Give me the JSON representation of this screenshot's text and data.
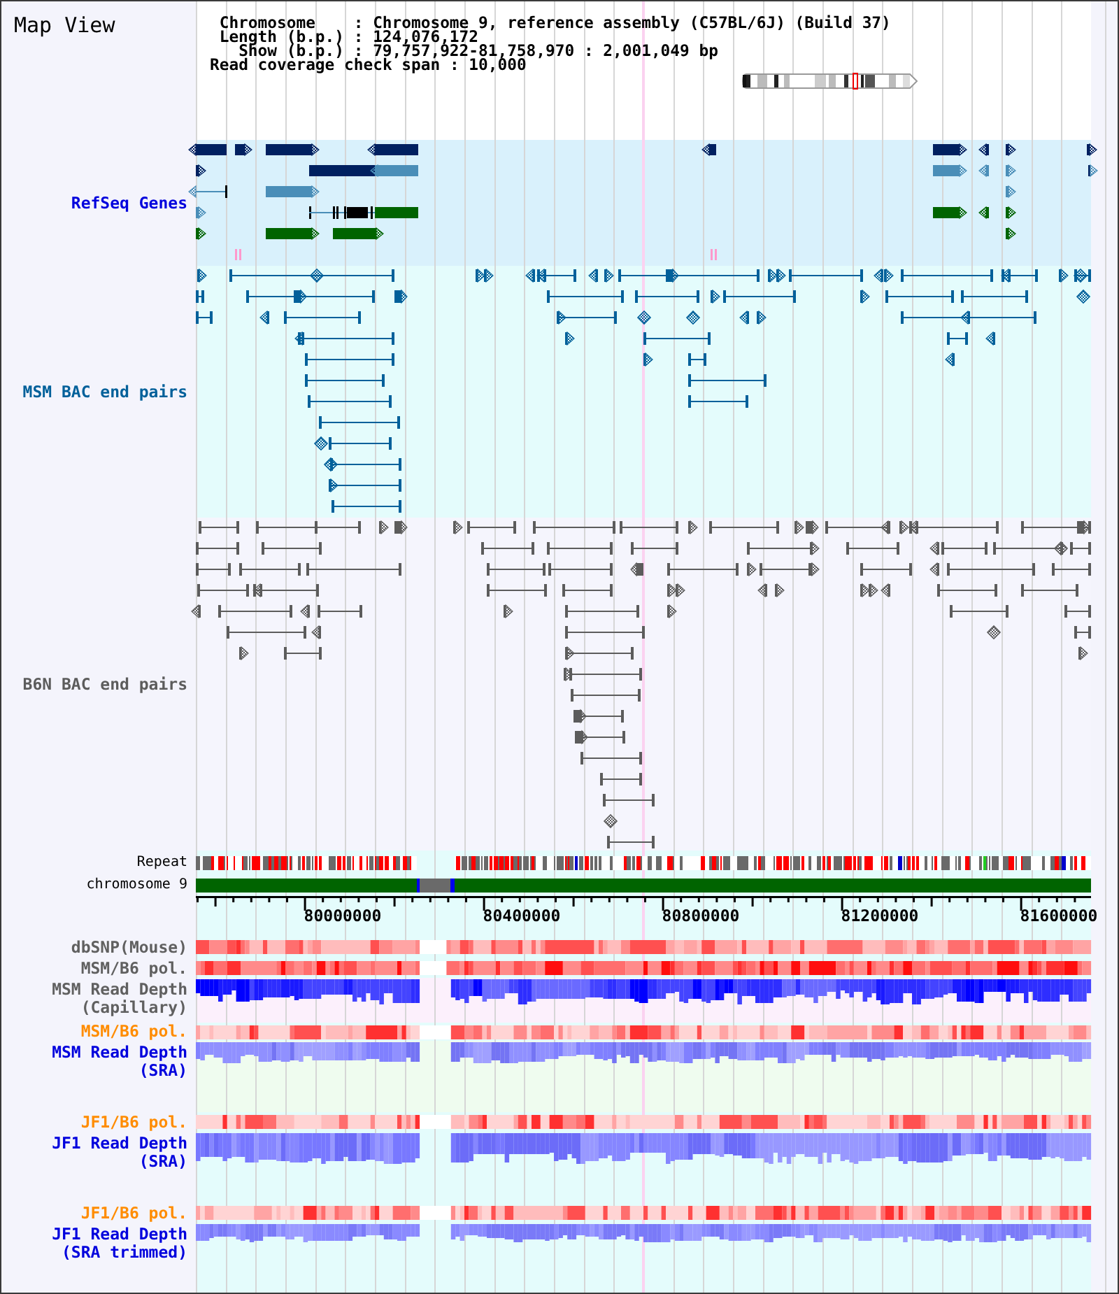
{
  "title": "Map View",
  "info": [
    "Chromosome    : Chromosome 9, reference assembly (C57BL/6J) (Build 37)",
    "Length (b.p.) : 124,076,172",
    "Show (b.p.) : 79,757,922-81,758,970 : 2,001,049 bp",
    "Read coverage check span : 10,000"
  ],
  "feature_tracks": [
    {
      "label": "RefSeq Genes",
      "kind": "genes",
      "color": "#0000dd"
    },
    {
      "label": "MSM BAC end pairs",
      "kind": "bac_pairs",
      "color": "#00609a"
    },
    {
      "label": "B6N BAC end pairs",
      "kind": "bac_pairs",
      "color": "#5c5c5c"
    }
  ],
  "reference_tracks": [
    {
      "label": "Repeat",
      "kind": "repeat"
    },
    {
      "label": "chromosome 9",
      "kind": "chromosome"
    }
  ],
  "axis_labels": [
    "80000000",
    "80400000",
    "80800000",
    "81200000",
    "81600000"
  ],
  "data_tracks": [
    {
      "label": "dbSNP(Mouse)",
      "kind": "heatmap",
      "color": "#606060"
    },
    {
      "label": "MSM/B6 pol.",
      "kind": "heatmap",
      "color": "#606060"
    },
    {
      "label": "MSM Read Depth (Capillary)",
      "kind": "depth",
      "color": "#606060"
    },
    {
      "label": "MSM/B6 pol.",
      "kind": "heatmap",
      "color": "#ff8c00"
    },
    {
      "label": "MSM Read Depth (SRA)",
      "kind": "depth",
      "color": "#0000dd"
    },
    {
      "label": "JF1/B6 pol.",
      "kind": "heatmap",
      "color": "#ff8c00"
    },
    {
      "label": "JF1 Read Depth (SRA)",
      "kind": "depth",
      "color": "#0000dd"
    },
    {
      "label": "JF1/B6 pol.",
      "kind": "heatmap",
      "color": "#ff8c00"
    },
    {
      "label": "JF1 Read Depth (SRA trimmed)",
      "kind": "depth",
      "color": "#0000dd"
    }
  ]
}
